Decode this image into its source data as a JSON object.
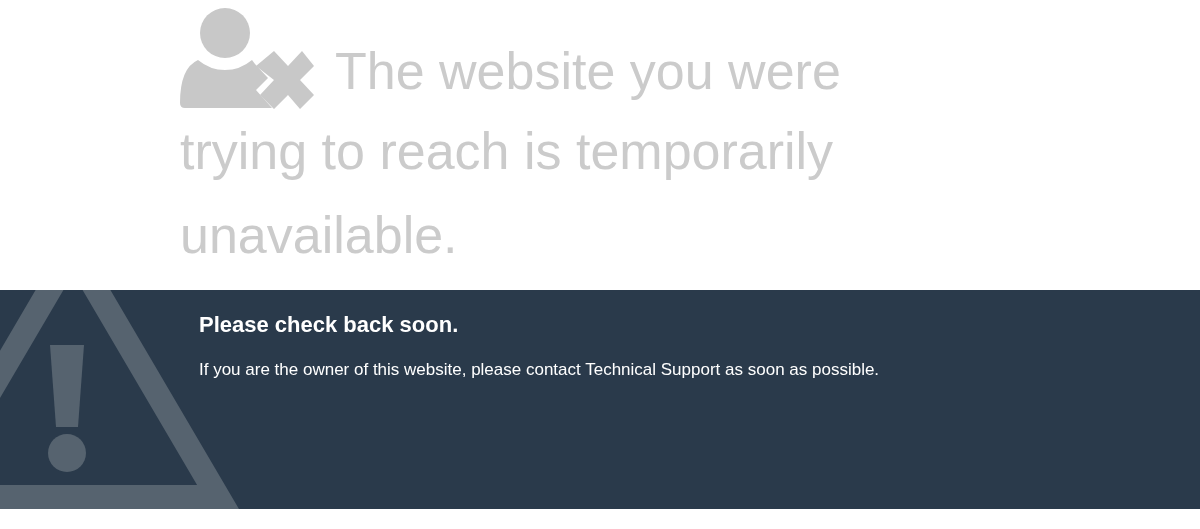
{
  "heading_lines": [
    "The website you were",
    "trying to reach is temporarily",
    "unavailable."
  ],
  "notice": {
    "title": "Please check back soon.",
    "message": "If you are the owner of this website, please contact Technical Support as soon as possible."
  }
}
